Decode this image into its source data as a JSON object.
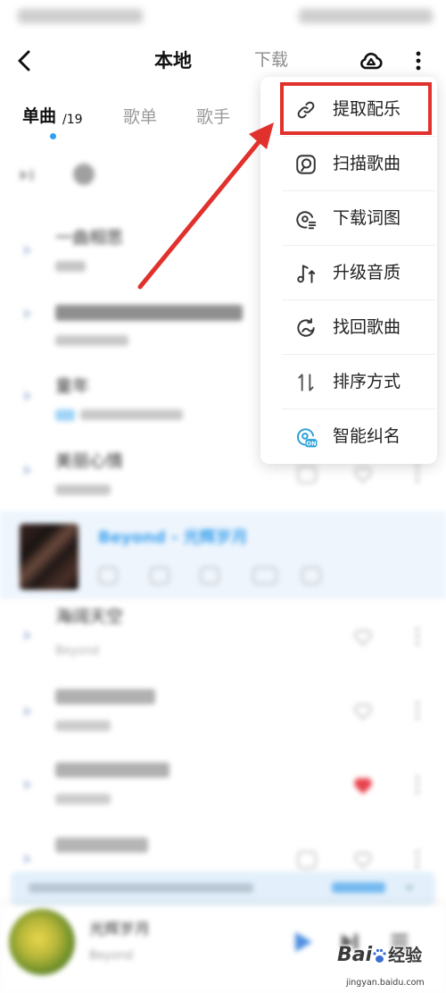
{
  "header": {
    "back_icon": "chevron-left-icon",
    "title": "本地",
    "download_tab": "下载",
    "cloud_icon": "cloud-upload-icon",
    "more_icon": "more-vertical-icon"
  },
  "tabs": [
    {
      "label": "单曲",
      "count": "/19",
      "active": true
    },
    {
      "label": "歌单",
      "active": false
    },
    {
      "label": "歌手",
      "active": false
    }
  ],
  "songs": [
    {
      "title": "一曲相思"
    },
    {
      "title": "童年"
    },
    {
      "title": "美丽心情"
    },
    {
      "title": "Beyond - 光辉岁月",
      "playing": true
    },
    {
      "title": "海阔天空",
      "artist": "Beyond"
    }
  ],
  "now_playing": {
    "title": "光辉岁月",
    "artist": "Beyond",
    "play_icon": "play-icon",
    "next_icon": "next-track-icon",
    "playlist_icon": "playlist-icon"
  },
  "menu": {
    "items": [
      {
        "label": "提取配乐",
        "icon": "link-icon",
        "highlighted": true
      },
      {
        "label": "扫描歌曲",
        "icon": "scan-icon"
      },
      {
        "label": "下载词图",
        "icon": "lyrics-download-icon"
      },
      {
        "label": "升级音质",
        "icon": "quality-upgrade-icon"
      },
      {
        "label": "找回歌曲",
        "icon": "recover-song-icon"
      },
      {
        "label": "排序方式",
        "icon": "sort-icon"
      },
      {
        "label": "智能纠名",
        "icon": "smart-rename-icon",
        "badge": "ON"
      }
    ]
  },
  "annotation": {
    "highlight_color": "#e1312d",
    "arrow_color": "#e1312d"
  },
  "watermark": {
    "brand": "Bai",
    "brand_cn": "经验",
    "url": "jingyan.baidu.com"
  },
  "colors": {
    "accent": "#2f9ff0",
    "playing_text": "#3fa3ee",
    "liked_heart": "#e8414c"
  }
}
